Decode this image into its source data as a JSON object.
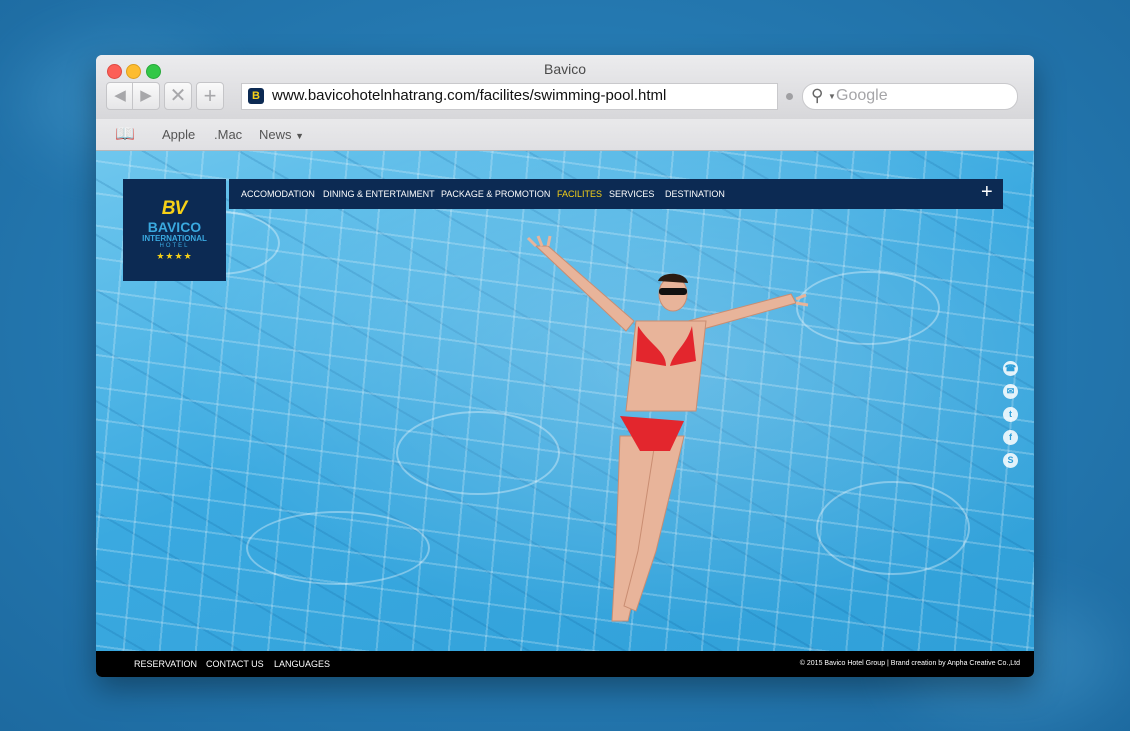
{
  "window": {
    "title": "Bavico"
  },
  "toolbar": {
    "back_icon": "back-arrow-icon",
    "forward_icon": "forward-arrow-icon",
    "stop_icon": "close-icon",
    "add_icon": "plus-icon",
    "url": "www.bavicohotelnhatrang.com/facilites/swimming-pool.html",
    "search_placeholder": "Google"
  },
  "bookmarks": {
    "items": [
      "Apple",
      ".Mac",
      "News"
    ]
  },
  "site": {
    "logo": {
      "mark": "BV",
      "name": "BAVICO",
      "sub": "INTERNATIONAL",
      "hotel": "HOTEL",
      "stars": "★★★★"
    },
    "nav": [
      "ACCOMODATION",
      "DINING & ENTERTAIMENT",
      "PACKAGE & PROMOTION",
      "FACILITES",
      "SERVICES",
      "DESTINATION"
    ],
    "active_nav": "FACILITES",
    "social_icons": [
      "phone-icon",
      "mail-icon",
      "twitter-icon",
      "facebook-icon",
      "skype-icon"
    ],
    "footer": {
      "links": [
        "RESERVATION",
        "CONTACT US",
        "LANGUAGES"
      ],
      "copyright": "© 2015 Bavico Hotel Group  |  Brand creation by Anpha Creative Co.,Ltd"
    }
  },
  "colors": {
    "brand_navy": "#0c2a53",
    "brand_yellow": "#f7d117",
    "water": "#3aa9e0"
  }
}
